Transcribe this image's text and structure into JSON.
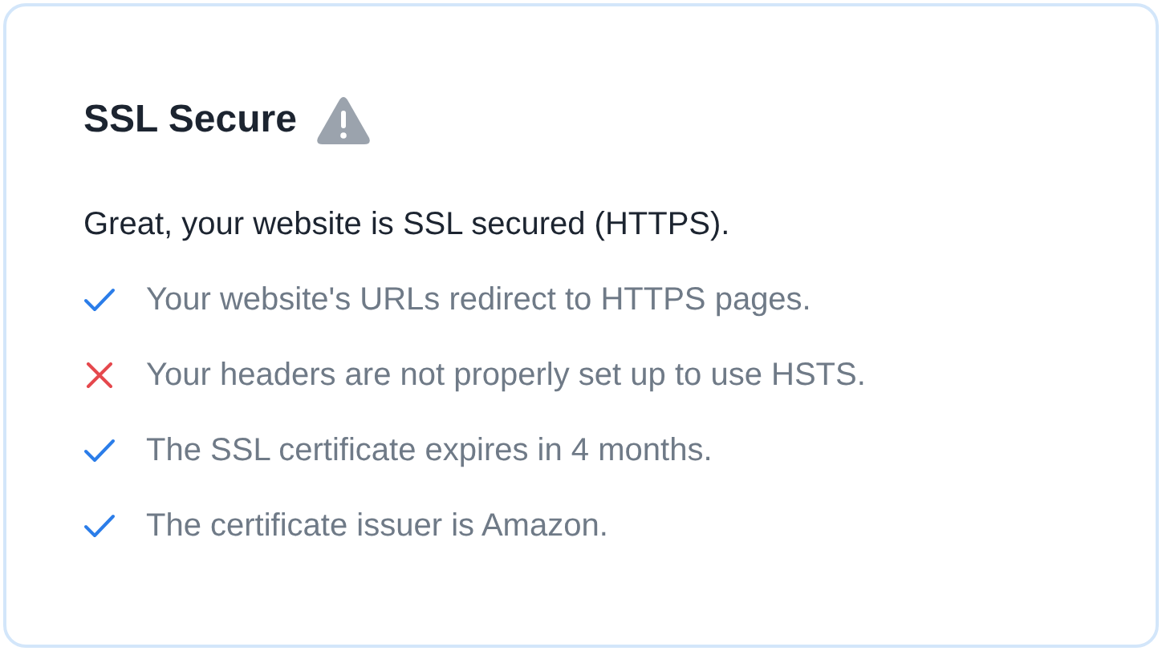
{
  "card": {
    "title": "SSL Secure",
    "summary": "Great, your website is SSL secured (HTTPS).",
    "checks": [
      {
        "kind": "pass",
        "text": "Your website's URLs redirect to HTTPS pages."
      },
      {
        "kind": "fail",
        "text": "Your headers are not properly set up to use HSTS."
      },
      {
        "kind": "pass",
        "text": "The SSL certificate expires in 4 months."
      },
      {
        "kind": "pass",
        "text": "The certificate issuer is Amazon."
      }
    ]
  }
}
